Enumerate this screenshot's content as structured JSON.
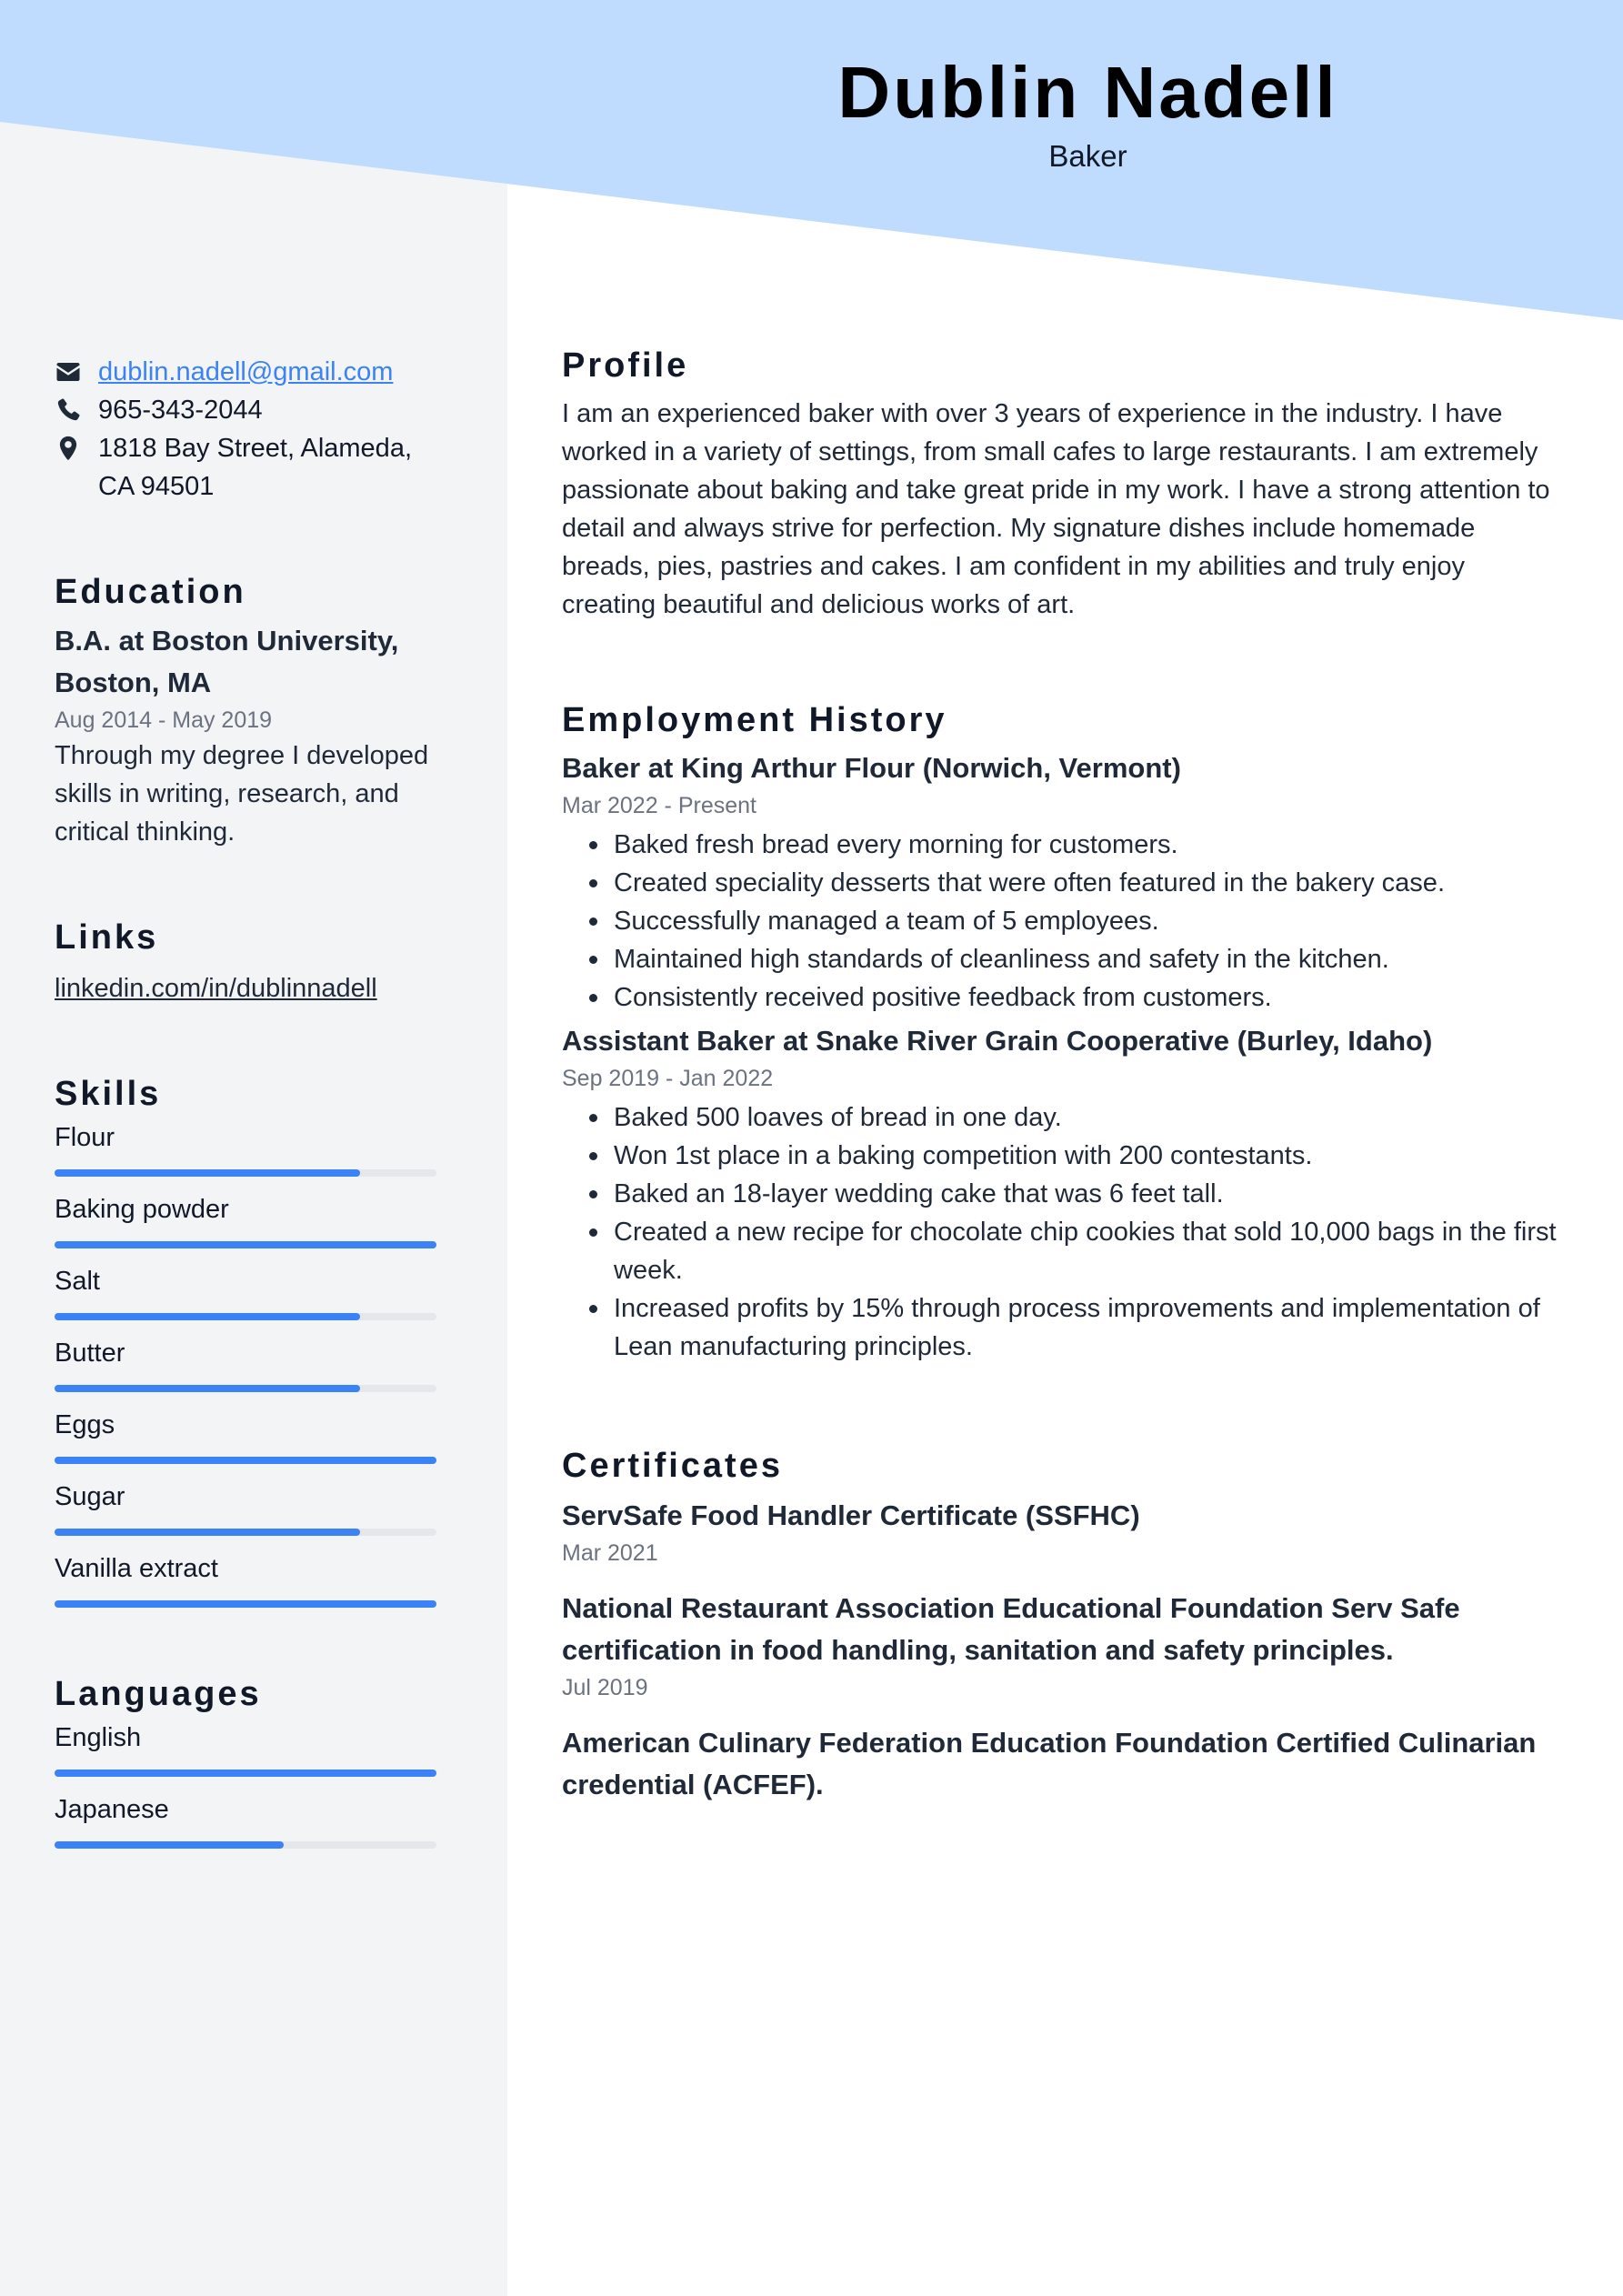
{
  "header": {
    "name": "Dublin Nadell",
    "job_title": "Baker"
  },
  "colors": {
    "banner": "#bfdbfe",
    "sidebar": "#f3f4f6",
    "accent": "#3b82f6",
    "bar_track": "#e5e7eb",
    "text": "#1f2937",
    "muted": "#6b7280"
  },
  "contact": {
    "email": "dublin.nadell@gmail.com",
    "phone": "965-343-2044",
    "address": "1818 Bay Street, Alameda, CA 94501",
    "icons": [
      "envelope-icon",
      "phone-icon",
      "map-pin-icon"
    ]
  },
  "education": {
    "heading": "Education",
    "items": [
      {
        "title": "B.A. at Boston University, Boston, MA",
        "dates": "Aug 2014 - May 2019",
        "description": "Through my degree I developed skills in writing, research, and critical thinking."
      }
    ]
  },
  "links": {
    "heading": "Links",
    "items": [
      {
        "label": "linkedin.com/in/dublinnadell"
      }
    ]
  },
  "skills": {
    "heading": "Skills",
    "items": [
      {
        "label": "Flour",
        "level_percent": 80
      },
      {
        "label": "Baking powder",
        "level_percent": 100
      },
      {
        "label": "Salt",
        "level_percent": 80
      },
      {
        "label": "Butter",
        "level_percent": 80
      },
      {
        "label": "Eggs",
        "level_percent": 100
      },
      {
        "label": "Sugar",
        "level_percent": 80
      },
      {
        "label": "Vanilla extract",
        "level_percent": 100
      }
    ]
  },
  "languages": {
    "heading": "Languages",
    "items": [
      {
        "label": "English",
        "level_percent": 100
      },
      {
        "label": "Japanese",
        "level_percent": 60
      }
    ]
  },
  "profile": {
    "heading": "Profile",
    "text": "I am an experienced baker with over 3 years of experience in the industry. I have worked in a variety of settings, from small cafes to large restaurants. I am extremely passionate about baking and take great pride in my work. I have a strong attention to detail and always strive for perfection. My signature dishes include homemade breads, pies, pastries and cakes. I am confident in my abilities and truly enjoy creating beautiful and delicious works of art."
  },
  "employment": {
    "heading": "Employment History",
    "jobs": [
      {
        "title": "Baker at King Arthur Flour (Norwich, Vermont)",
        "dates": "Mar 2022 - Present",
        "bullets": [
          "Baked fresh bread every morning for customers.",
          "Created speciality desserts that were often featured in the bakery case.",
          "Successfully managed a team of 5 employees.",
          "Maintained high standards of cleanliness and safety in the kitchen.",
          "Consistently received positive feedback from customers."
        ]
      },
      {
        "title": "Assistant Baker at Snake River Grain Cooperative (Burley, Idaho)",
        "dates": "Sep 2019 - Jan 2022",
        "bullets": [
          "Baked 500 loaves of bread in one day.",
          "Won 1st place in a baking competition with 200 contestants.",
          "Baked an 18-layer wedding cake that was 6 feet tall.",
          "Created a new recipe for chocolate chip cookies that sold 10,000 bags in the first week.",
          "Increased profits by 15% through process improvements and implementation of Lean manufacturing principles."
        ]
      }
    ]
  },
  "certificates": {
    "heading": "Certificates",
    "items": [
      {
        "title": "ServSafe Food Handler Certificate (SSFHC)",
        "date": "Mar 2021"
      },
      {
        "title": "National Restaurant Association Educational Foundation Serv Safe certification in food handling, sanitation and safety principles.",
        "date": "Jul 2019"
      },
      {
        "title": "American Culinary Federation Education Foundation Certified Culinarian credential (ACFEF).",
        "date": ""
      }
    ]
  }
}
